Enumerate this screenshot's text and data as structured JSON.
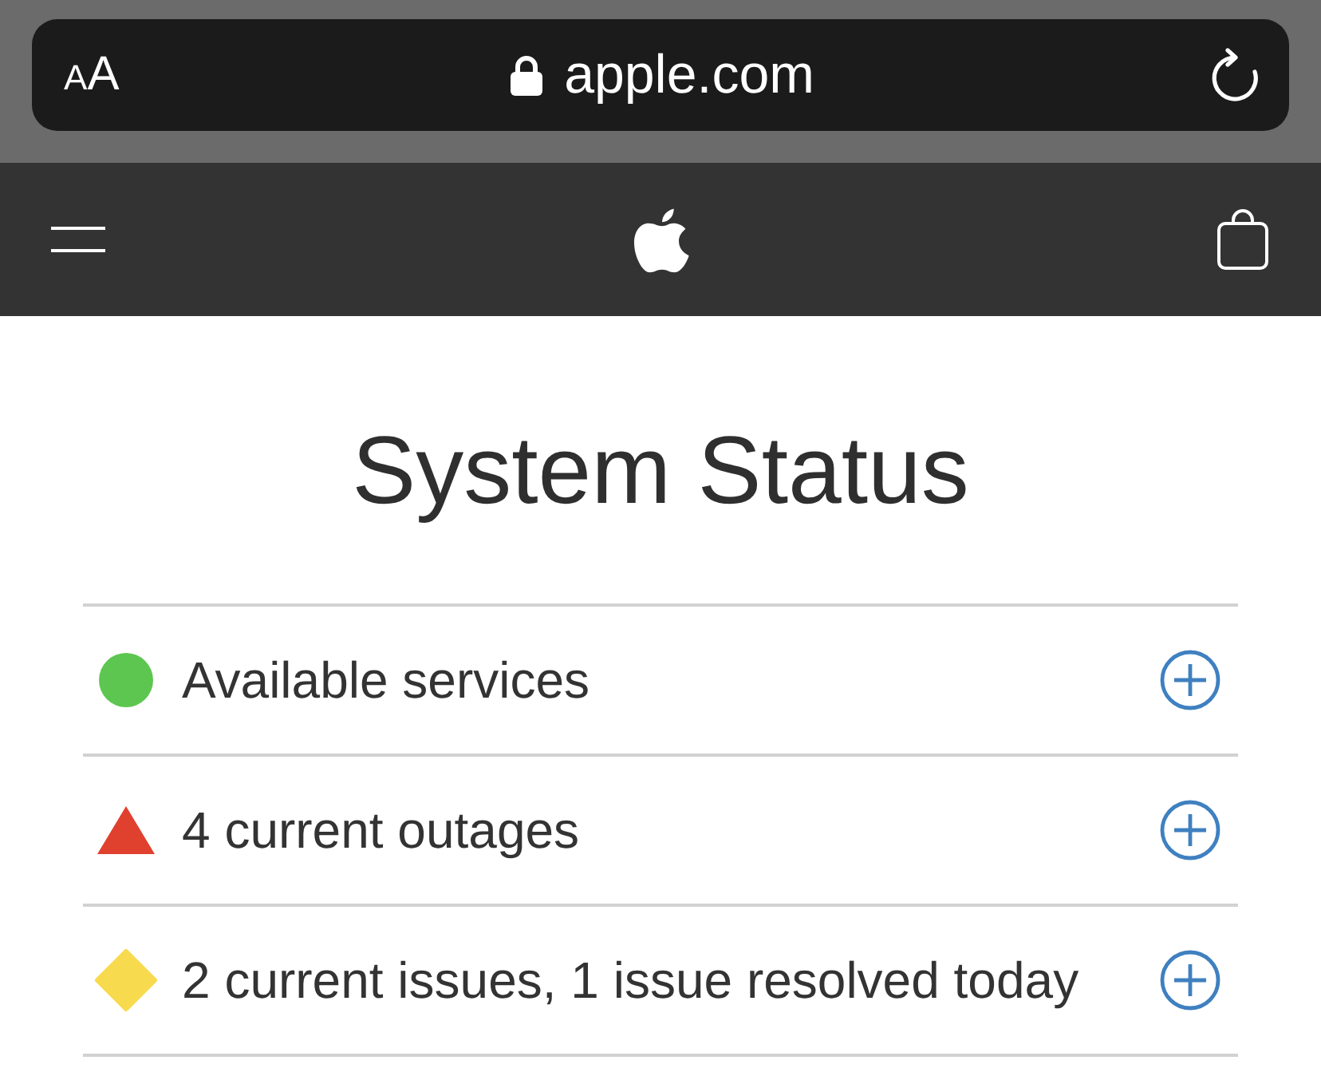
{
  "browser_bar": {
    "text_size_button": "AA",
    "url": "apple.com"
  },
  "page": {
    "title": "System Status",
    "statuses": [
      {
        "kind": "available",
        "color": "#5dc650",
        "label": "Available services",
        "expanded": false
      },
      {
        "kind": "outage",
        "color": "#e0402e",
        "label": "4 current outages",
        "expanded": false
      },
      {
        "kind": "issue",
        "color": "#f8da4e",
        "label": "2 current issues, 1 issue resolved today",
        "expanded": false
      }
    ]
  }
}
